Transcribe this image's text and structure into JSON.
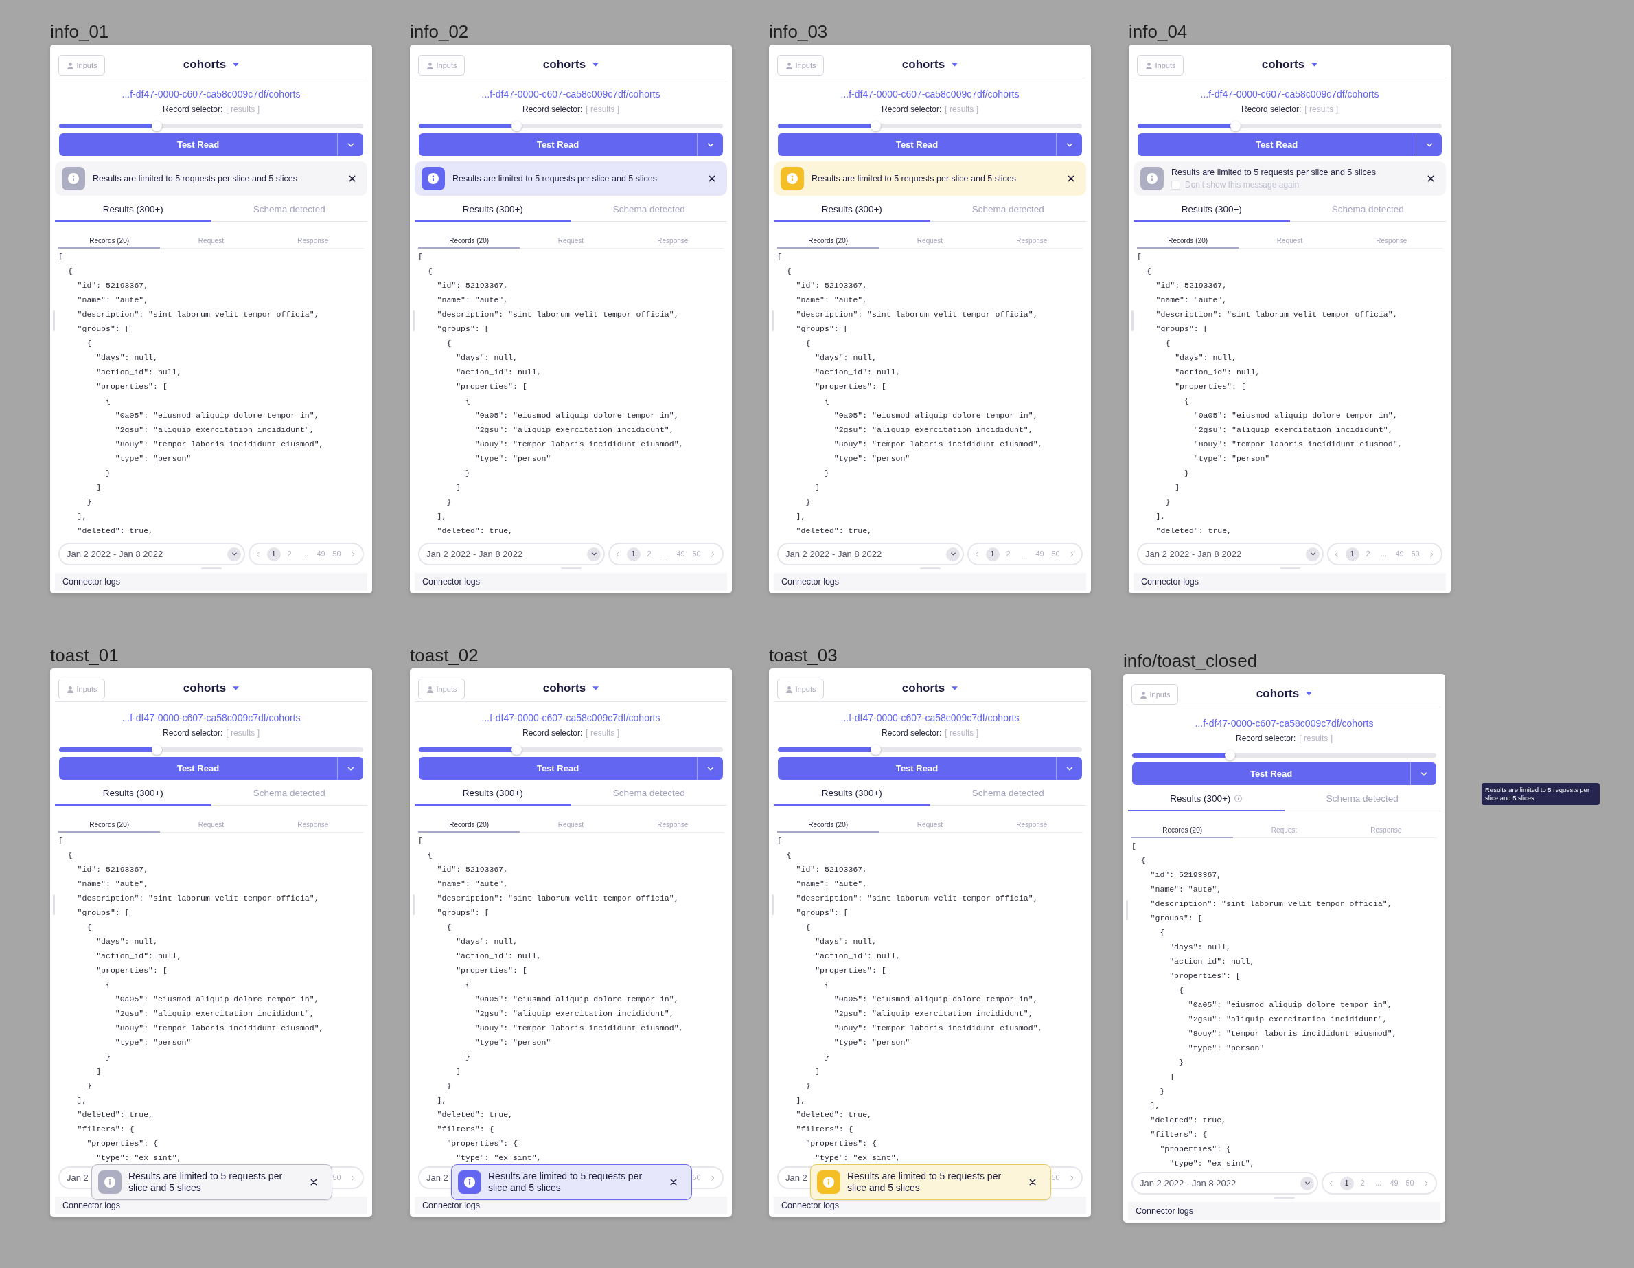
{
  "frames": [
    {
      "label": "info_01",
      "inputs_button": "Inputs",
      "stream": "cohorts",
      "url": "...f-df47-0000-c607-ca58c009c7df/cohorts",
      "record_selector": {
        "label": "Record selector:",
        "value": "[ results ]"
      },
      "slider": {
        "level": 0.32
      },
      "test_read_button": "Test Read",
      "notice": {
        "kind": "neutral",
        "text": "Results are limited to 5 requests per slice and 5 slices"
      },
      "tabs": [
        {
          "label": "Results (300+)",
          "selected": true
        },
        {
          "label": "Schema detected",
          "selected": false
        }
      ],
      "subtabs": [
        {
          "label": "Records (20)",
          "selected": true
        },
        {
          "label": "Request",
          "selected": false
        },
        {
          "label": "Response",
          "selected": false
        }
      ],
      "code_lines": [
        "[",
        "  {",
        "    \"id\": 52193367,",
        "    \"name\": \"aute\",",
        "    \"description\": \"sint laborum velit tempor officia\",",
        "    \"groups\": [",
        "      {",
        "        \"days\": null,",
        "        \"action_id\": null,",
        "        \"properties\": [",
        "          {",
        "            \"0a05\": \"eiusmod aliquip dolore tempor in\",",
        "            \"2gsu\": \"aliquip exercitation incididunt\",",
        "            \"8ouy\": \"tempor laboris incididunt eiusmod\",",
        "            \"type\": \"person\"",
        "          }",
        "        ]",
        "      }",
        "    ],",
        "    \"deleted\": true,"
      ],
      "date_range": {
        "text": "Jan 2 2022 - Jan 8 2022",
        "chevron": true
      },
      "pagination": {
        "prev": true,
        "pages": [
          {
            "label": "1",
            "selected": true
          },
          {
            "label": "2",
            "selected": false
          },
          {
            "label": "...",
            "selected": false
          },
          {
            "label": "49",
            "selected": false
          },
          {
            "label": "50",
            "selected": false
          }
        ],
        "next": true
      },
      "logs": "Connector logs"
    },
    {
      "label": "info_02",
      "inputs_button": "Inputs",
      "stream": "cohorts",
      "url": "...f-df47-0000-c607-ca58c009c7df/cohorts",
      "record_selector": {
        "label": "Record selector:",
        "value": "[ results ]"
      },
      "slider": {
        "level": 0.32
      },
      "test_read_button": "Test Read",
      "notice": {
        "kind": "info",
        "text": "Results are limited to 5 requests per slice and 5 slices"
      },
      "tabs": [
        {
          "label": "Results (300+)",
          "selected": true
        },
        {
          "label": "Schema detected",
          "selected": false
        }
      ],
      "subtabs": [
        {
          "label": "Records (20)",
          "selected": true
        },
        {
          "label": "Request",
          "selected": false
        },
        {
          "label": "Response",
          "selected": false
        }
      ],
      "code_lines": [
        "[",
        "  {",
        "    \"id\": 52193367,",
        "    \"name\": \"aute\",",
        "    \"description\": \"sint laborum velit tempor officia\",",
        "    \"groups\": [",
        "      {",
        "        \"days\": null,",
        "        \"action_id\": null,",
        "        \"properties\": [",
        "          {",
        "            \"0a05\": \"eiusmod aliquip dolore tempor in\",",
        "            \"2gsu\": \"aliquip exercitation incididunt\",",
        "            \"8ouy\": \"tempor laboris incididunt eiusmod\",",
        "            \"type\": \"person\"",
        "          }",
        "        ]",
        "      }",
        "    ],",
        "    \"deleted\": true,"
      ],
      "date_range": {
        "text": "Jan 2 2022 - Jan 8 2022",
        "chevron": true
      },
      "pagination": {
        "prev": true,
        "pages": [
          {
            "label": "1",
            "selected": true
          },
          {
            "label": "2",
            "selected": false
          },
          {
            "label": "...",
            "selected": false
          },
          {
            "label": "49",
            "selected": false
          },
          {
            "label": "50",
            "selected": false
          }
        ],
        "next": true
      },
      "logs": "Connector logs"
    },
    {
      "label": "info_03",
      "inputs_button": "Inputs",
      "stream": "cohorts",
      "url": "...f-df47-0000-c607-ca58c009c7df/cohorts",
      "record_selector": {
        "label": "Record selector:",
        "value": "[ results ]"
      },
      "slider": {
        "level": 0.32
      },
      "test_read_button": "Test Read",
      "notice": {
        "kind": "warning",
        "text": "Results are limited to 5 requests per slice and 5 slices"
      },
      "tabs": [
        {
          "label": "Results (300+)",
          "selected": true
        },
        {
          "label": "Schema detected",
          "selected": false
        }
      ],
      "subtabs": [
        {
          "label": "Records (20)",
          "selected": true
        },
        {
          "label": "Request",
          "selected": false
        },
        {
          "label": "Response",
          "selected": false
        }
      ],
      "code_lines": [
        "[",
        "  {",
        "    \"id\": 52193367,",
        "    \"name\": \"aute\",",
        "    \"description\": \"sint laborum velit tempor officia\",",
        "    \"groups\": [",
        "      {",
        "        \"days\": null,",
        "        \"action_id\": null,",
        "        \"properties\": [",
        "          {",
        "            \"0a05\": \"eiusmod aliquip dolore tempor in\",",
        "            \"2gsu\": \"aliquip exercitation incididunt\",",
        "            \"8ouy\": \"tempor laboris incididunt eiusmod\",",
        "            \"type\": \"person\"",
        "          }",
        "        ]",
        "      }",
        "    ],",
        "    \"deleted\": true,"
      ],
      "date_range": {
        "text": "Jan 2 2022 - Jan 8 2022",
        "chevron": true
      },
      "pagination": {
        "prev": true,
        "pages": [
          {
            "label": "1",
            "selected": true
          },
          {
            "label": "2",
            "selected": false
          },
          {
            "label": "...",
            "selected": false
          },
          {
            "label": "49",
            "selected": false
          },
          {
            "label": "50",
            "selected": false
          }
        ],
        "next": true
      },
      "logs": "Connector logs"
    },
    {
      "label": "info_04",
      "inputs_button": "Inputs",
      "stream": "cohorts",
      "url": "...f-df47-0000-c607-ca58c009c7df/cohorts",
      "record_selector": {
        "label": "Record selector:",
        "value": "[ results ]"
      },
      "slider": {
        "level": 0.32
      },
      "test_read_button": "Test Read",
      "notice": {
        "kind": "neutral",
        "text": "Results are limited to 5 requests per slice and 5 slices",
        "dont_show": {
          "label": "Don’t show this message again",
          "checked": false
        }
      },
      "tabs": [
        {
          "label": "Results (300+)",
          "selected": true
        },
        {
          "label": "Schema detected",
          "selected": false
        }
      ],
      "subtabs": [
        {
          "label": "Records (20)",
          "selected": true
        },
        {
          "label": "Request",
          "selected": false
        },
        {
          "label": "Response",
          "selected": false
        }
      ],
      "code_lines": [
        "[",
        "  {",
        "    \"id\": 52193367,",
        "    \"name\": \"aute\",",
        "    \"description\": \"sint laborum velit tempor officia\",",
        "    \"groups\": [",
        "      {",
        "        \"days\": null,",
        "        \"action_id\": null,",
        "        \"properties\": [",
        "          {",
        "            \"0a05\": \"eiusmod aliquip dolore tempor in\",",
        "            \"2gsu\": \"aliquip exercitation incididunt\",",
        "            \"8ouy\": \"tempor laboris incididunt eiusmod\",",
        "            \"type\": \"person\"",
        "          }",
        "        ]",
        "      }",
        "    ],",
        "    \"deleted\": true,"
      ],
      "date_range": {
        "text": "Jan 2 2022 - Jan 8 2022",
        "chevron": true
      },
      "pagination": {
        "prev": true,
        "pages": [
          {
            "label": "1",
            "selected": true
          },
          {
            "label": "2",
            "selected": false
          },
          {
            "label": "...",
            "selected": false
          },
          {
            "label": "49",
            "selected": false
          },
          {
            "label": "50",
            "selected": false
          }
        ],
        "next": true
      },
      "logs": "Connector logs"
    },
    {
      "label": "toast_01",
      "inputs_button": "Inputs",
      "stream": "cohorts",
      "url": "...f-df47-0000-c607-ca58c009c7df/cohorts",
      "record_selector": {
        "label": "Record selector:",
        "value": "[ results ]"
      },
      "slider": {
        "level": 0.32
      },
      "test_read_button": "Test Read",
      "tabs": [
        {
          "label": "Results (300+)",
          "selected": true
        },
        {
          "label": "Schema detected",
          "selected": false
        }
      ],
      "subtabs": [
        {
          "label": "Records (20)",
          "selected": true
        },
        {
          "label": "Request",
          "selected": false
        },
        {
          "label": "Response",
          "selected": false
        }
      ],
      "code_lines": [
        "[",
        "  {",
        "    \"id\": 52193367,",
        "    \"name\": \"aute\",",
        "    \"description\": \"sint laborum velit tempor officia\",",
        "    \"groups\": [",
        "      {",
        "        \"days\": null,",
        "        \"action_id\": null,",
        "        \"properties\": [",
        "          {",
        "            \"0a05\": \"eiusmod aliquip dolore tempor in\",",
        "            \"2gsu\": \"aliquip exercitation incididunt\",",
        "            \"8ouy\": \"tempor laboris incididunt eiusmod\",",
        "            \"type\": \"person\"",
        "          }",
        "        ]",
        "      }",
        "    ],",
        "    \"deleted\": true,",
        "    \"filters\": {",
        "      \"properties\": {",
        "        \"type\": \"ex sint\","
      ],
      "date_range": {
        "text": "Jan 2",
        "chevron": false
      },
      "pagination": {
        "prev": false,
        "pages": [
          {
            "label": "50",
            "selected": false
          }
        ],
        "next": true
      },
      "logs": "Connector logs",
      "toast": {
        "kind": "neutral",
        "text": "Results are limited to 5 requests per slice and 5 slices"
      }
    },
    {
      "label": "toast_02",
      "inputs_button": "Inputs",
      "stream": "cohorts",
      "url": "...f-df47-0000-c607-ca58c009c7df/cohorts",
      "record_selector": {
        "label": "Record selector:",
        "value": "[ results ]"
      },
      "slider": {
        "level": 0.32
      },
      "test_read_button": "Test Read",
      "tabs": [
        {
          "label": "Results (300+)",
          "selected": true
        },
        {
          "label": "Schema detected",
          "selected": false
        }
      ],
      "subtabs": [
        {
          "label": "Records (20)",
          "selected": true
        },
        {
          "label": "Request",
          "selected": false
        },
        {
          "label": "Response",
          "selected": false
        }
      ],
      "code_lines": [
        "[",
        "  {",
        "    \"id\": 52193367,",
        "    \"name\": \"aute\",",
        "    \"description\": \"sint laborum velit tempor officia\",",
        "    \"groups\": [",
        "      {",
        "        \"days\": null,",
        "        \"action_id\": null,",
        "        \"properties\": [",
        "          {",
        "            \"0a05\": \"eiusmod aliquip dolore tempor in\",",
        "            \"2gsu\": \"aliquip exercitation incididunt\",",
        "            \"8ouy\": \"tempor laboris incididunt eiusmod\",",
        "            \"type\": \"person\"",
        "          }",
        "        ]",
        "      }",
        "    ],",
        "    \"deleted\": true,",
        "    \"filters\": {",
        "      \"properties\": {",
        "        \"type\": \"ex sint\","
      ],
      "date_range": {
        "text": "Jan 2",
        "chevron": false
      },
      "pagination": {
        "prev": false,
        "pages": [
          {
            "label": "50",
            "selected": false
          }
        ],
        "next": true
      },
      "logs": "Connector logs",
      "toast": {
        "kind": "info",
        "text": "Results are limited to 5 requests per slice and 5 slices"
      }
    },
    {
      "label": "toast_03",
      "inputs_button": "Inputs",
      "stream": "cohorts",
      "url": "...f-df47-0000-c607-ca58c009c7df/cohorts",
      "record_selector": {
        "label": "Record selector:",
        "value": "[ results ]"
      },
      "slider": {
        "level": 0.32
      },
      "test_read_button": "Test Read",
      "tabs": [
        {
          "label": "Results (300+)",
          "selected": true
        },
        {
          "label": "Schema detected",
          "selected": false
        }
      ],
      "subtabs": [
        {
          "label": "Records (20)",
          "selected": true
        },
        {
          "label": "Request",
          "selected": false
        },
        {
          "label": "Response",
          "selected": false
        }
      ],
      "code_lines": [
        "[",
        "  {",
        "    \"id\": 52193367,",
        "    \"name\": \"aute\",",
        "    \"description\": \"sint laborum velit tempor officia\",",
        "    \"groups\": [",
        "      {",
        "        \"days\": null,",
        "        \"action_id\": null,",
        "        \"properties\": [",
        "          {",
        "            \"0a05\": \"eiusmod aliquip dolore tempor in\",",
        "            \"2gsu\": \"aliquip exercitation incididunt\",",
        "            \"8ouy\": \"tempor laboris incididunt eiusmod\",",
        "            \"type\": \"person\"",
        "          }",
        "        ]",
        "      }",
        "    ],",
        "    \"deleted\": true,",
        "    \"filters\": {",
        "      \"properties\": {",
        "        \"type\": \"ex sint\","
      ],
      "date_range": {
        "text": "Jan 2",
        "chevron": false
      },
      "pagination": {
        "prev": false,
        "pages": [
          {
            "label": "50",
            "selected": false
          }
        ],
        "next": true
      },
      "logs": "Connector logs",
      "toast": {
        "kind": "warning",
        "text": "Results are limited to 5 requests per slice and 5 slices"
      }
    },
    {
      "label": "info/toast_closed",
      "inputs_button": "Inputs",
      "stream": "cohorts",
      "url": "...f-df47-0000-c607-ca58c009c7df/cohorts",
      "record_selector": {
        "label": "Record selector:",
        "value": "[ results ]"
      },
      "slider": {
        "level": 0.32
      },
      "test_read_button": "Test Read",
      "tabs": [
        {
          "label": "Results (300+)",
          "selected": true,
          "info_icon": true
        },
        {
          "label": "Schema detected",
          "selected": false
        }
      ],
      "subtabs": [
        {
          "label": "Records (20)",
          "selected": true
        },
        {
          "label": "Request",
          "selected": false
        },
        {
          "label": "Response",
          "selected": false
        }
      ],
      "code_lines": [
        "[",
        "  {",
        "    \"id\": 52193367,",
        "    \"name\": \"aute\",",
        "    \"description\": \"sint laborum velit tempor officia\",",
        "    \"groups\": [",
        "      {",
        "        \"days\": null,",
        "        \"action_id\": null,",
        "        \"properties\": [",
        "          {",
        "            \"0a05\": \"eiusmod aliquip dolore tempor in\",",
        "            \"2gsu\": \"aliquip exercitation incididunt\",",
        "            \"8ouy\": \"tempor laboris incididunt eiusmod\",",
        "            \"type\": \"person\"",
        "          }",
        "        ]",
        "      }",
        "    ],",
        "    \"deleted\": true,",
        "    \"filters\": {",
        "      \"properties\": {",
        "        \"type\": \"ex sint\","
      ],
      "date_range": {
        "text": "Jan 2 2022 - Jan 8 2022",
        "chevron": true
      },
      "pagination": {
        "prev": true,
        "pages": [
          {
            "label": "1",
            "selected": true
          },
          {
            "label": "2",
            "selected": false
          },
          {
            "label": "...",
            "selected": false
          },
          {
            "label": "49",
            "selected": false
          },
          {
            "label": "50",
            "selected": false
          }
        ],
        "next": true
      },
      "logs": "Connector logs"
    }
  ],
  "tooltip": {
    "text": "Results are limited to 5 requests per slice and 5 slices"
  }
}
